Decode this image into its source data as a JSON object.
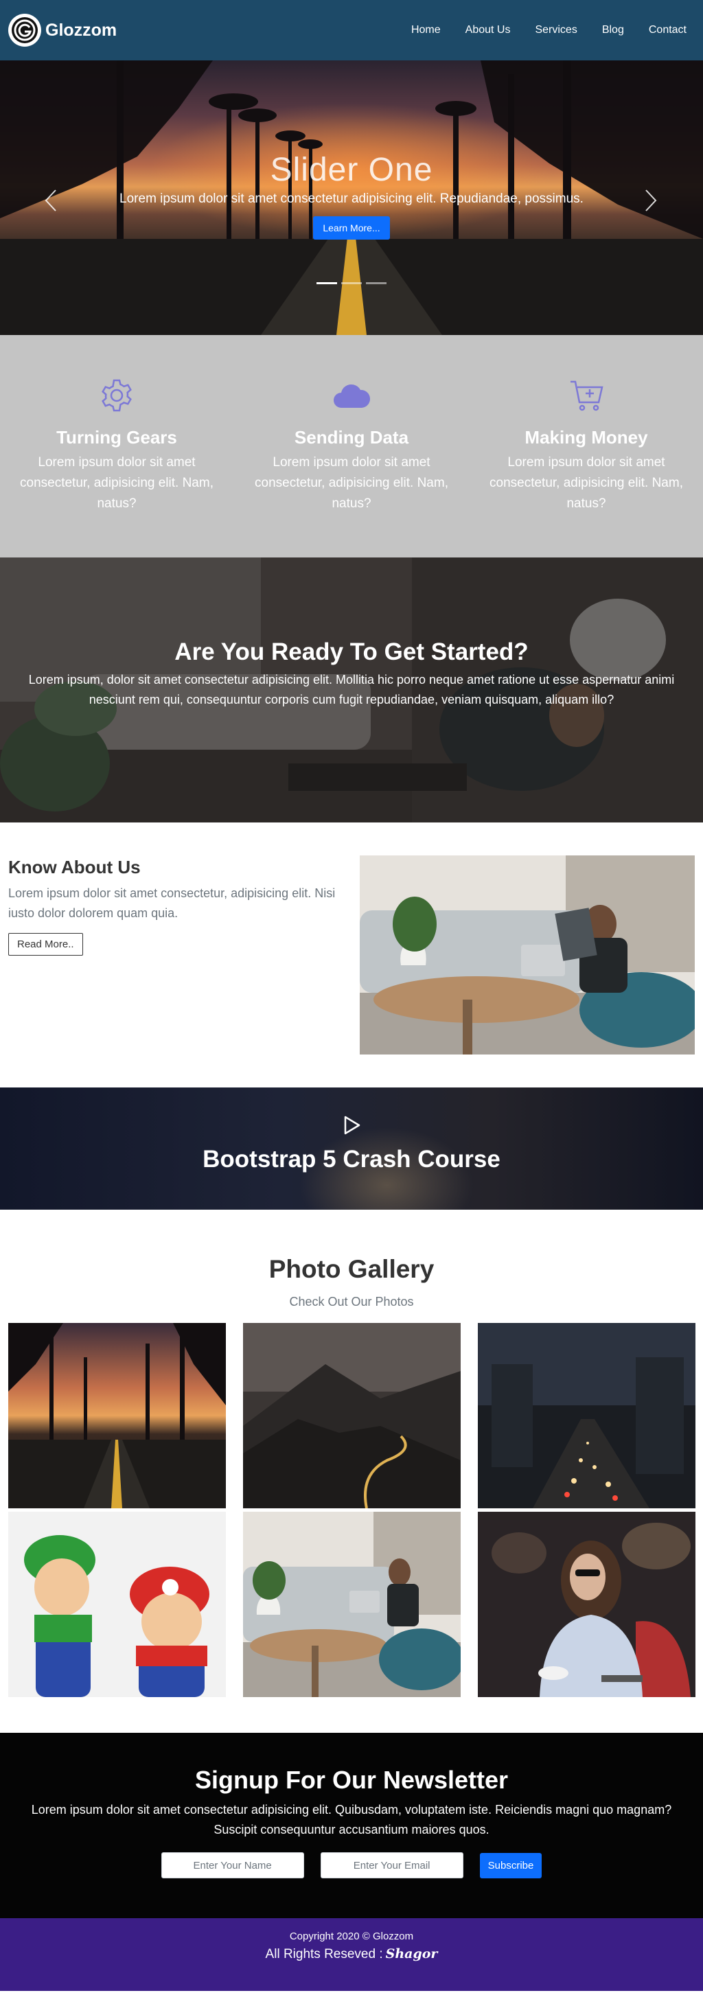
{
  "navbar": {
    "brand": "Glozzom",
    "links": [
      "Home",
      "About Us",
      "Services",
      "Blog",
      "Contact"
    ]
  },
  "hero": {
    "title": "Slider One",
    "text": "Lorem ipsum dolor sit amet consectetur adipisicing elit. Repudiandae, possimus.",
    "button": "Learn More...",
    "slide_count": 3,
    "active_slide": 1
  },
  "features": [
    {
      "icon": "gear-icon",
      "title": "Turning Gears",
      "text": "Lorem ipsum dolor sit amet consectetur, adipisicing elit. Nam, natus?"
    },
    {
      "icon": "cloud-icon",
      "title": "Sending Data",
      "text": "Lorem ipsum dolor sit amet consectetur, adipisicing elit. Nam, natus?"
    },
    {
      "icon": "cart-plus-icon",
      "title": "Making Money",
      "text": "Lorem ipsum dolor sit amet consectetur, adipisicing elit. Nam, natus?"
    }
  ],
  "ready": {
    "title": "Are You Ready To Get Started?",
    "text": "Lorem ipsum, dolor sit amet consectetur adipisicing elit. Mollitia hic porro neque amet ratione ut esse aspernatur animi nesciunt rem qui, consequuntur corporis cum fugit repudiandae, veniam quisquam, aliquam illo?"
  },
  "about": {
    "title": "Know About Us",
    "text": "Lorem ipsum dolor sit amet consectetur, adipisicing elit. Nisi iusto dolor dolorem quam quia.",
    "button": "Read More.."
  },
  "video": {
    "title": "Bootstrap 5 Crash Course"
  },
  "gallery": {
    "title": "Photo Gallery",
    "subtitle": "Check Out Our Photos"
  },
  "newsletter": {
    "title": "Signup For Our Newsletter",
    "text": "Lorem ipsum dolor sit amet consectetur adipisicing elit. Quibusdam, voluptatem iste. Reiciendis magni quo magnam? Suscipit consequuntur accusantium maiores quos.",
    "name_placeholder": "Enter Your Name",
    "email_placeholder": "Enter Your Email",
    "button": "Subscribe"
  },
  "footer": {
    "copyright": "Copyright 2020 © Glozzom",
    "rights": "All Rights Reseved :",
    "author": "Shagor"
  },
  "colors": {
    "navbar": "#1d4a68",
    "primary": "#0d6efd",
    "feature_icon": "#7c78d6",
    "features_bg": "#c4c4c4",
    "footer_bg": "#3b1e86",
    "newsletter_bg": "#050505"
  }
}
